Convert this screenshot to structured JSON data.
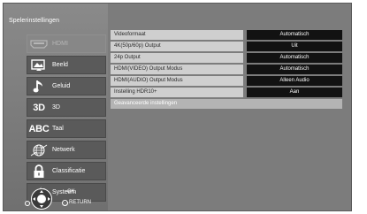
{
  "page_title": "Spelerinstellingen",
  "menu": [
    {
      "label": "HDMI",
      "icon": "hdmi-icon",
      "disabled": true
    },
    {
      "label": "Beeld",
      "icon": "picture-icon",
      "disabled": false
    },
    {
      "label": "Geluid",
      "icon": "music-note-icon",
      "disabled": false
    },
    {
      "label": "3D",
      "icon": "3d-icon",
      "icon_text": "3D",
      "disabled": false
    },
    {
      "label": "Taal",
      "icon": "abc-icon",
      "icon_text": "ABC",
      "disabled": false
    },
    {
      "label": "Netwerk",
      "icon": "network-icon",
      "disabled": false
    },
    {
      "label": "Classificatie",
      "icon": "lock-icon",
      "disabled": false
    },
    {
      "label": "Systeem",
      "icon": "wrench-icon",
      "disabled": false
    }
  ],
  "settings": [
    {
      "name": "Videoformaat",
      "value": "Automatisch"
    },
    {
      "name": "4K(50p/60p) Output",
      "value": "Uit"
    },
    {
      "name": "24p Output",
      "value": "Automatisch"
    },
    {
      "name": "HDMI(VIDEO) Output Modus",
      "value": "Automatisch"
    },
    {
      "name": "HDMI(AUDIO) Output Modus",
      "value": "Alleen Audio"
    },
    {
      "name": "Instelling HDR10+",
      "value": "Aan"
    },
    {
      "name": "Geavanceerde instellingen",
      "value": null
    }
  ],
  "help": {
    "ok_label": "OK",
    "return_label": "RETURN"
  },
  "colors": {
    "panel": "#7c7c7c",
    "menu_item": "#5a5a5a",
    "setting_name": "#cfcfcf",
    "setting_value": "#121212"
  }
}
